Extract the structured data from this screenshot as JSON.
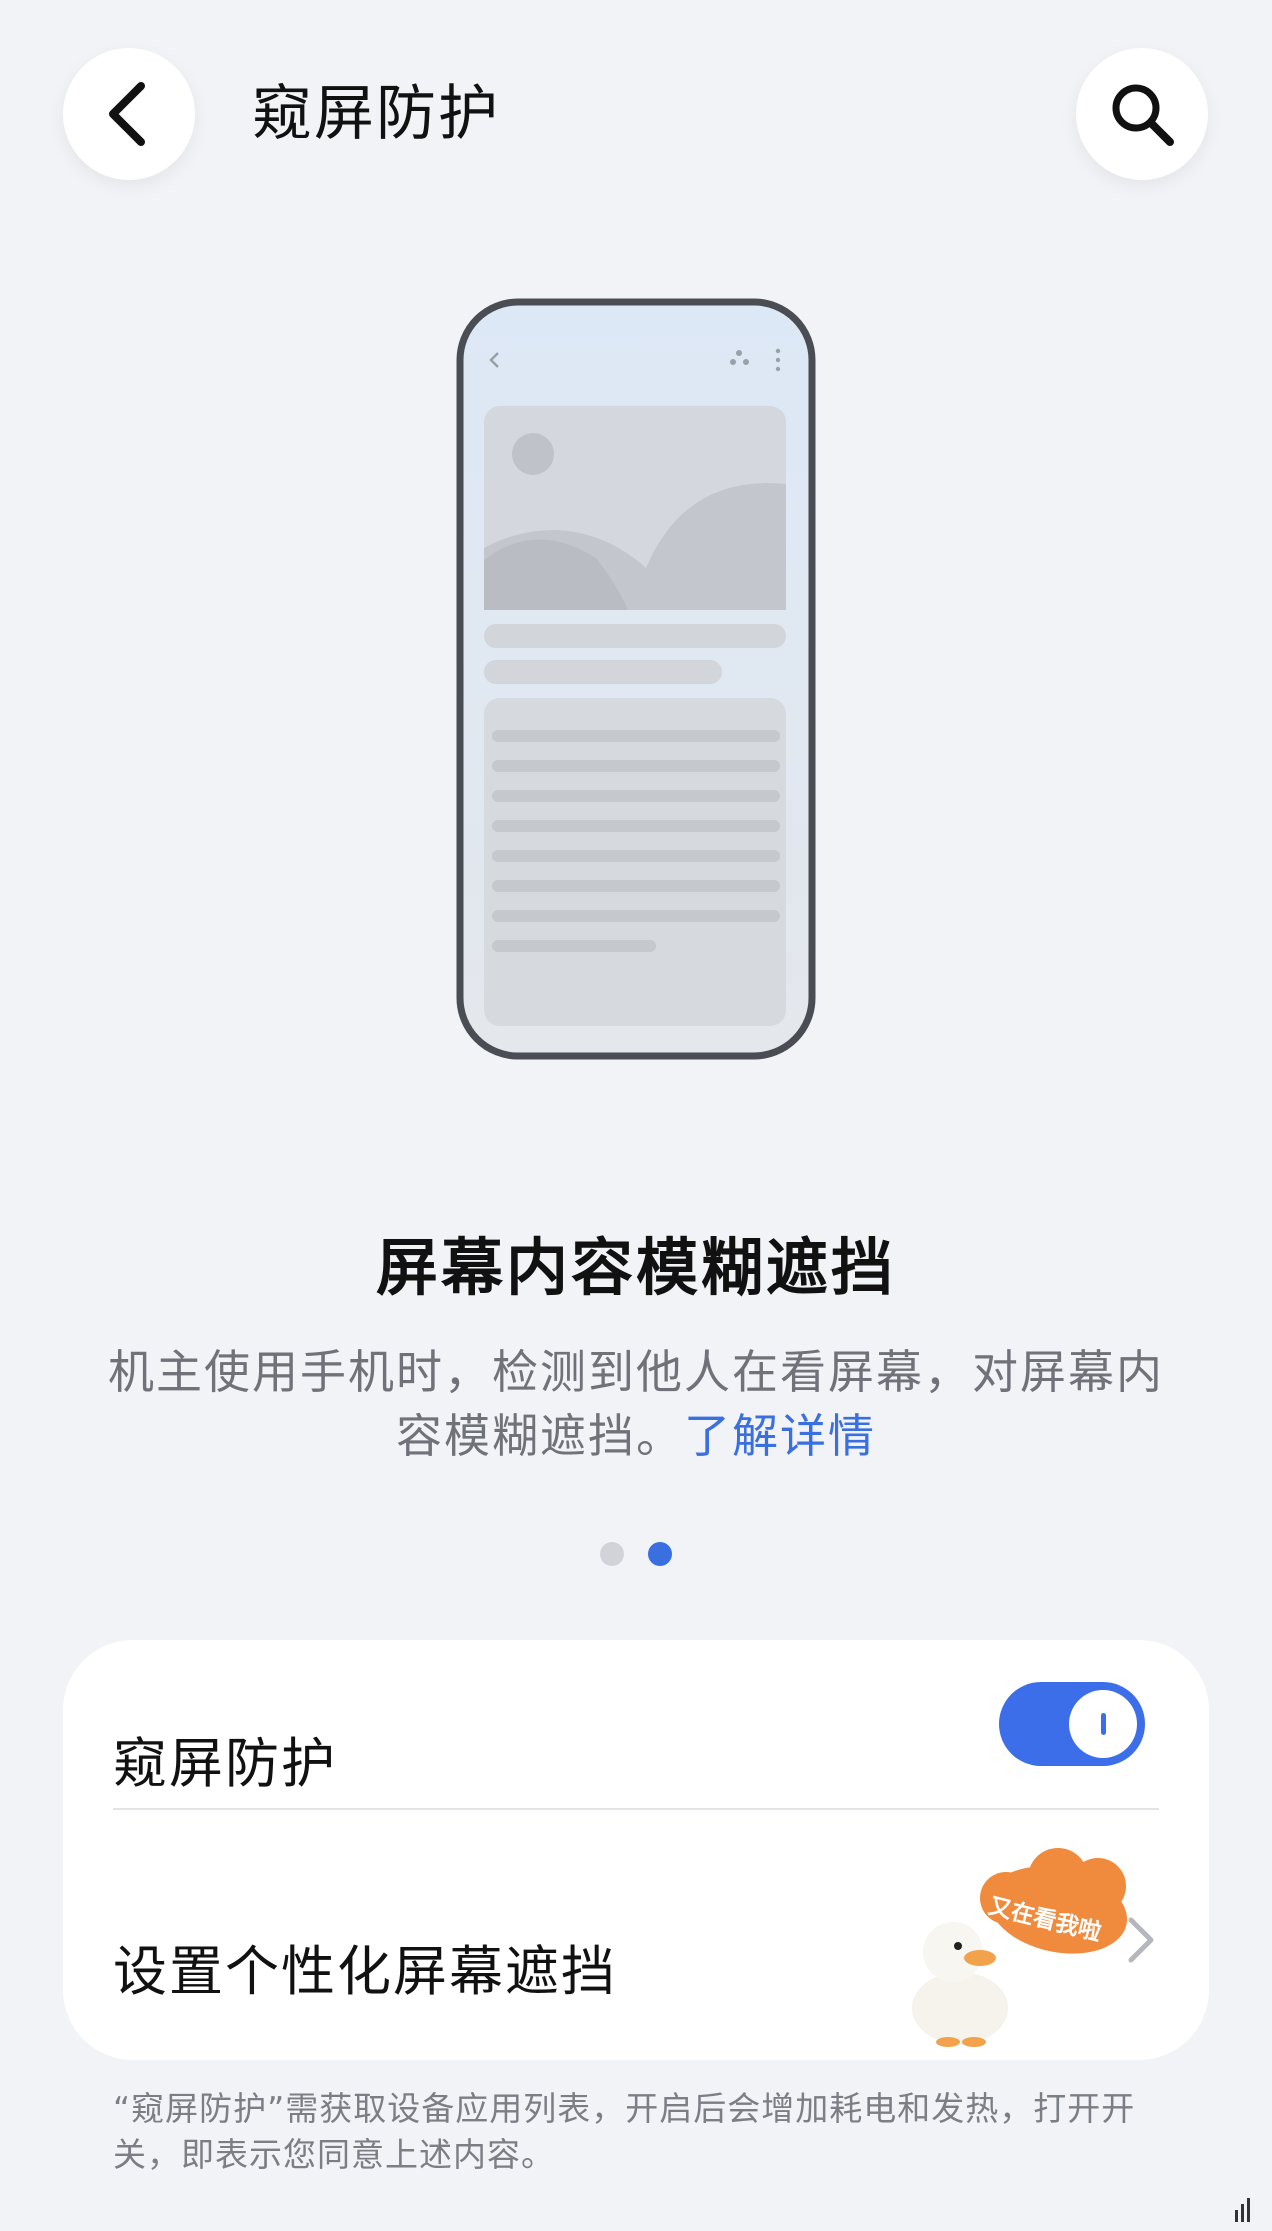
{
  "header": {
    "title": "窥屏防护",
    "back_icon": "chevron-left-icon",
    "search_icon": "search-icon"
  },
  "illustration": {
    "description_icon": "phone-mockup-illustration"
  },
  "feature": {
    "title": "屏幕内容模糊遮挡",
    "description": "机主使用手机时，检测到他人在看屏幕，对屏幕内容模糊遮挡。",
    "learn_more": "了解详情"
  },
  "pager": {
    "count": 2,
    "active_index": 1
  },
  "settings": {
    "privacy_toggle": {
      "label": "窥屏防护",
      "enabled": true
    },
    "custom_mask": {
      "label": "设置个性化屏幕遮挡",
      "sticker_text": "又在看我啦"
    }
  },
  "footnote": "“窥屏防护”需获取设备应用列表，开启后会增加耗电和发热，打开开关，即表示您同意上述内容。",
  "colors": {
    "accent": "#3b6ee8",
    "background": "#f2f3f7",
    "link": "#3a6fe0"
  }
}
